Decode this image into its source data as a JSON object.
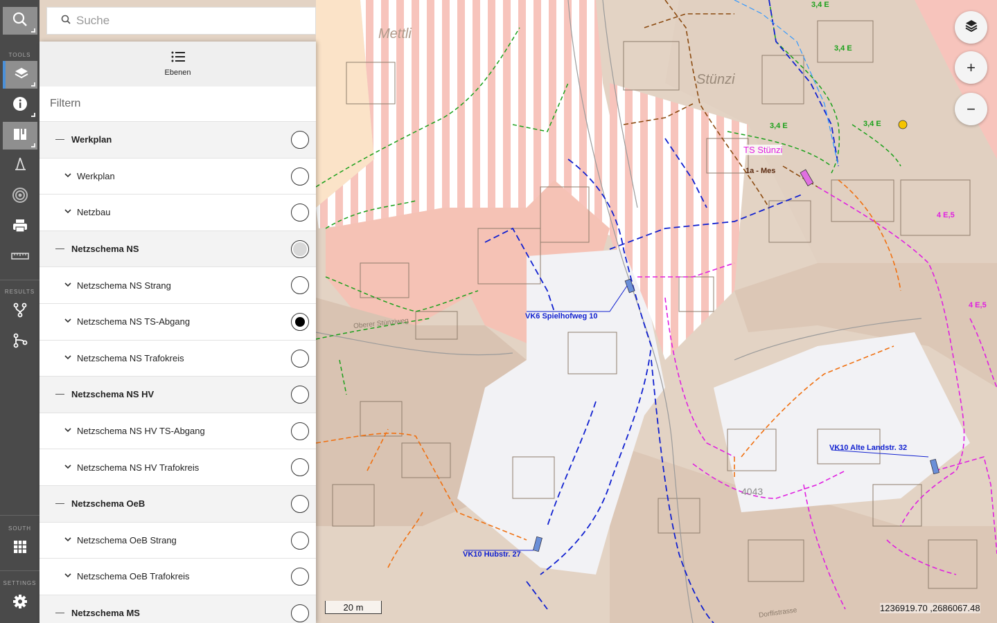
{
  "search": {
    "placeholder": "Suche"
  },
  "toolbar": {
    "tools_label": "TOOLS",
    "results_label": "RESULTS",
    "south_label": "SOUTH",
    "settings_label": "SETTINGS"
  },
  "panel": {
    "header_label": "Ebenen",
    "filter_placeholder": "Filtern",
    "layers": [
      {
        "label": "Werkplan",
        "group": true,
        "state": "off"
      },
      {
        "label": "Werkplan",
        "group": false,
        "state": "off"
      },
      {
        "label": "Netzbau",
        "group": false,
        "state": "off"
      },
      {
        "label": "Netzschema NS",
        "group": true,
        "state": "partial"
      },
      {
        "label": "Netzschema NS Strang",
        "group": false,
        "state": "off"
      },
      {
        "label": "Netzschema NS TS-Abgang",
        "group": false,
        "state": "on"
      },
      {
        "label": "Netzschema NS Trafokreis",
        "group": false,
        "state": "off"
      },
      {
        "label": "Netzschema NS HV",
        "group": true,
        "state": "off"
      },
      {
        "label": "Netzschema NS HV TS-Abgang",
        "group": false,
        "state": "off"
      },
      {
        "label": "Netzschema NS HV Trafokreis",
        "group": false,
        "state": "off"
      },
      {
        "label": "Netzschema OeB",
        "group": true,
        "state": "off"
      },
      {
        "label": "Netzschema OeB Strang",
        "group": false,
        "state": "off"
      },
      {
        "label": "Netzschema OeB Trafokreis",
        "group": false,
        "state": "off"
      },
      {
        "label": "Netzschema MS",
        "group": true,
        "state": "off"
      }
    ]
  },
  "map": {
    "labels": {
      "mettli": "Mettli",
      "stunzi": "Stünzi",
      "ts_stunzi": "TS Stünzi",
      "mes": "1a - Mes",
      "vk6": "VK6 Spielhofweg 10",
      "vk10_alte": "VK10 Alte Landstr. 32",
      "vk10_hub": "VK10 Hubstr. 27",
      "e34_a": "3,4 E",
      "e34_b": "3,4 E",
      "e34_c": "3,4 E",
      "e34_d": "3,4 E",
      "e45_a": "4 E,5",
      "e45_b": "4 E,5",
      "n4043": "4043",
      "dorfli": "Dorflistrasse",
      "obere": "Oberer Stünziweg"
    },
    "colors": {
      "parcel": "#dcc8b8",
      "pink_zone": "#f7c1b8",
      "green": "#1aa01a",
      "blue": "#1020d0",
      "magenta": "#e020e0",
      "orange": "#f07010",
      "brown": "#8b4a10"
    }
  },
  "scale": {
    "label": "20 m"
  },
  "coords": {
    "text": "1236919.70 ,2686067.48"
  },
  "buttons": {
    "zoom_in": "+",
    "zoom_out": "−"
  }
}
